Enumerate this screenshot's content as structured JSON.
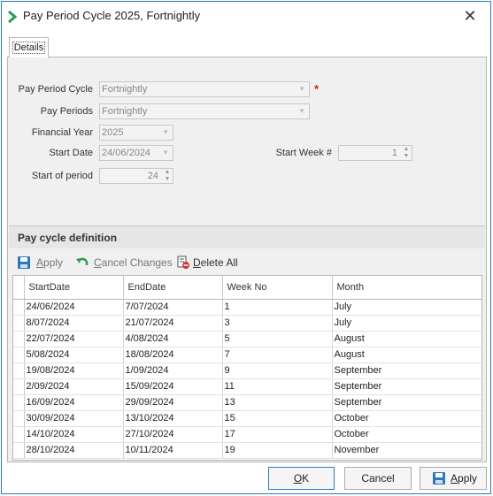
{
  "window": {
    "title": "Pay Period Cycle 2025, Fortnightly"
  },
  "tabs": [
    {
      "label": "Details"
    }
  ],
  "form": {
    "pay_period_cycle_label": "Pay Period Cycle",
    "pay_period_cycle_value": "Fortnightly",
    "required_mark": "*",
    "pay_periods_label": "Pay Periods",
    "pay_periods_value": "Fortnightly",
    "financial_year_label": "Financial Year",
    "financial_year_value": "2025",
    "start_date_label": "Start Date",
    "start_date_value": "24/06/2024",
    "start_of_period_label": "Start of period",
    "start_of_period_value": "24",
    "start_week_label": "Start Week #",
    "start_week_value": "1"
  },
  "section": {
    "title": "Pay cycle definition"
  },
  "toolbar": {
    "apply_underline": "A",
    "apply_rest": "pply",
    "cancel_underline": "C",
    "cancel_rest": "ancel Changes",
    "delete_underline": "D",
    "delete_rest": "elete All"
  },
  "grid": {
    "columns": [
      "StartDate",
      "EndDate",
      "Week No",
      "Month"
    ],
    "rows": [
      [
        "24/06/2024",
        "7/07/2024",
        "1",
        "July"
      ],
      [
        "8/07/2024",
        "21/07/2024",
        "3",
        "July"
      ],
      [
        "22/07/2024",
        "4/08/2024",
        "5",
        "August"
      ],
      [
        "5/08/2024",
        "18/08/2024",
        "7",
        "August"
      ],
      [
        "19/08/2024",
        "1/09/2024",
        "9",
        "September"
      ],
      [
        "2/09/2024",
        "15/09/2024",
        "11",
        "September"
      ],
      [
        "16/09/2024",
        "29/09/2024",
        "13",
        "September"
      ],
      [
        "30/09/2024",
        "13/10/2024",
        "15",
        "October"
      ],
      [
        "14/10/2024",
        "27/10/2024",
        "17",
        "October"
      ],
      [
        "28/10/2024",
        "10/11/2024",
        "19",
        "November"
      ]
    ]
  },
  "buttons": {
    "ok_underline": "O",
    "ok_rest": "K",
    "cancel": "Cancel",
    "apply_underline": "A",
    "apply_rest": "pply"
  },
  "colors": {
    "accent": "#2b79c2",
    "brand_icon": "#1e9e5a",
    "required": "#d32020"
  }
}
